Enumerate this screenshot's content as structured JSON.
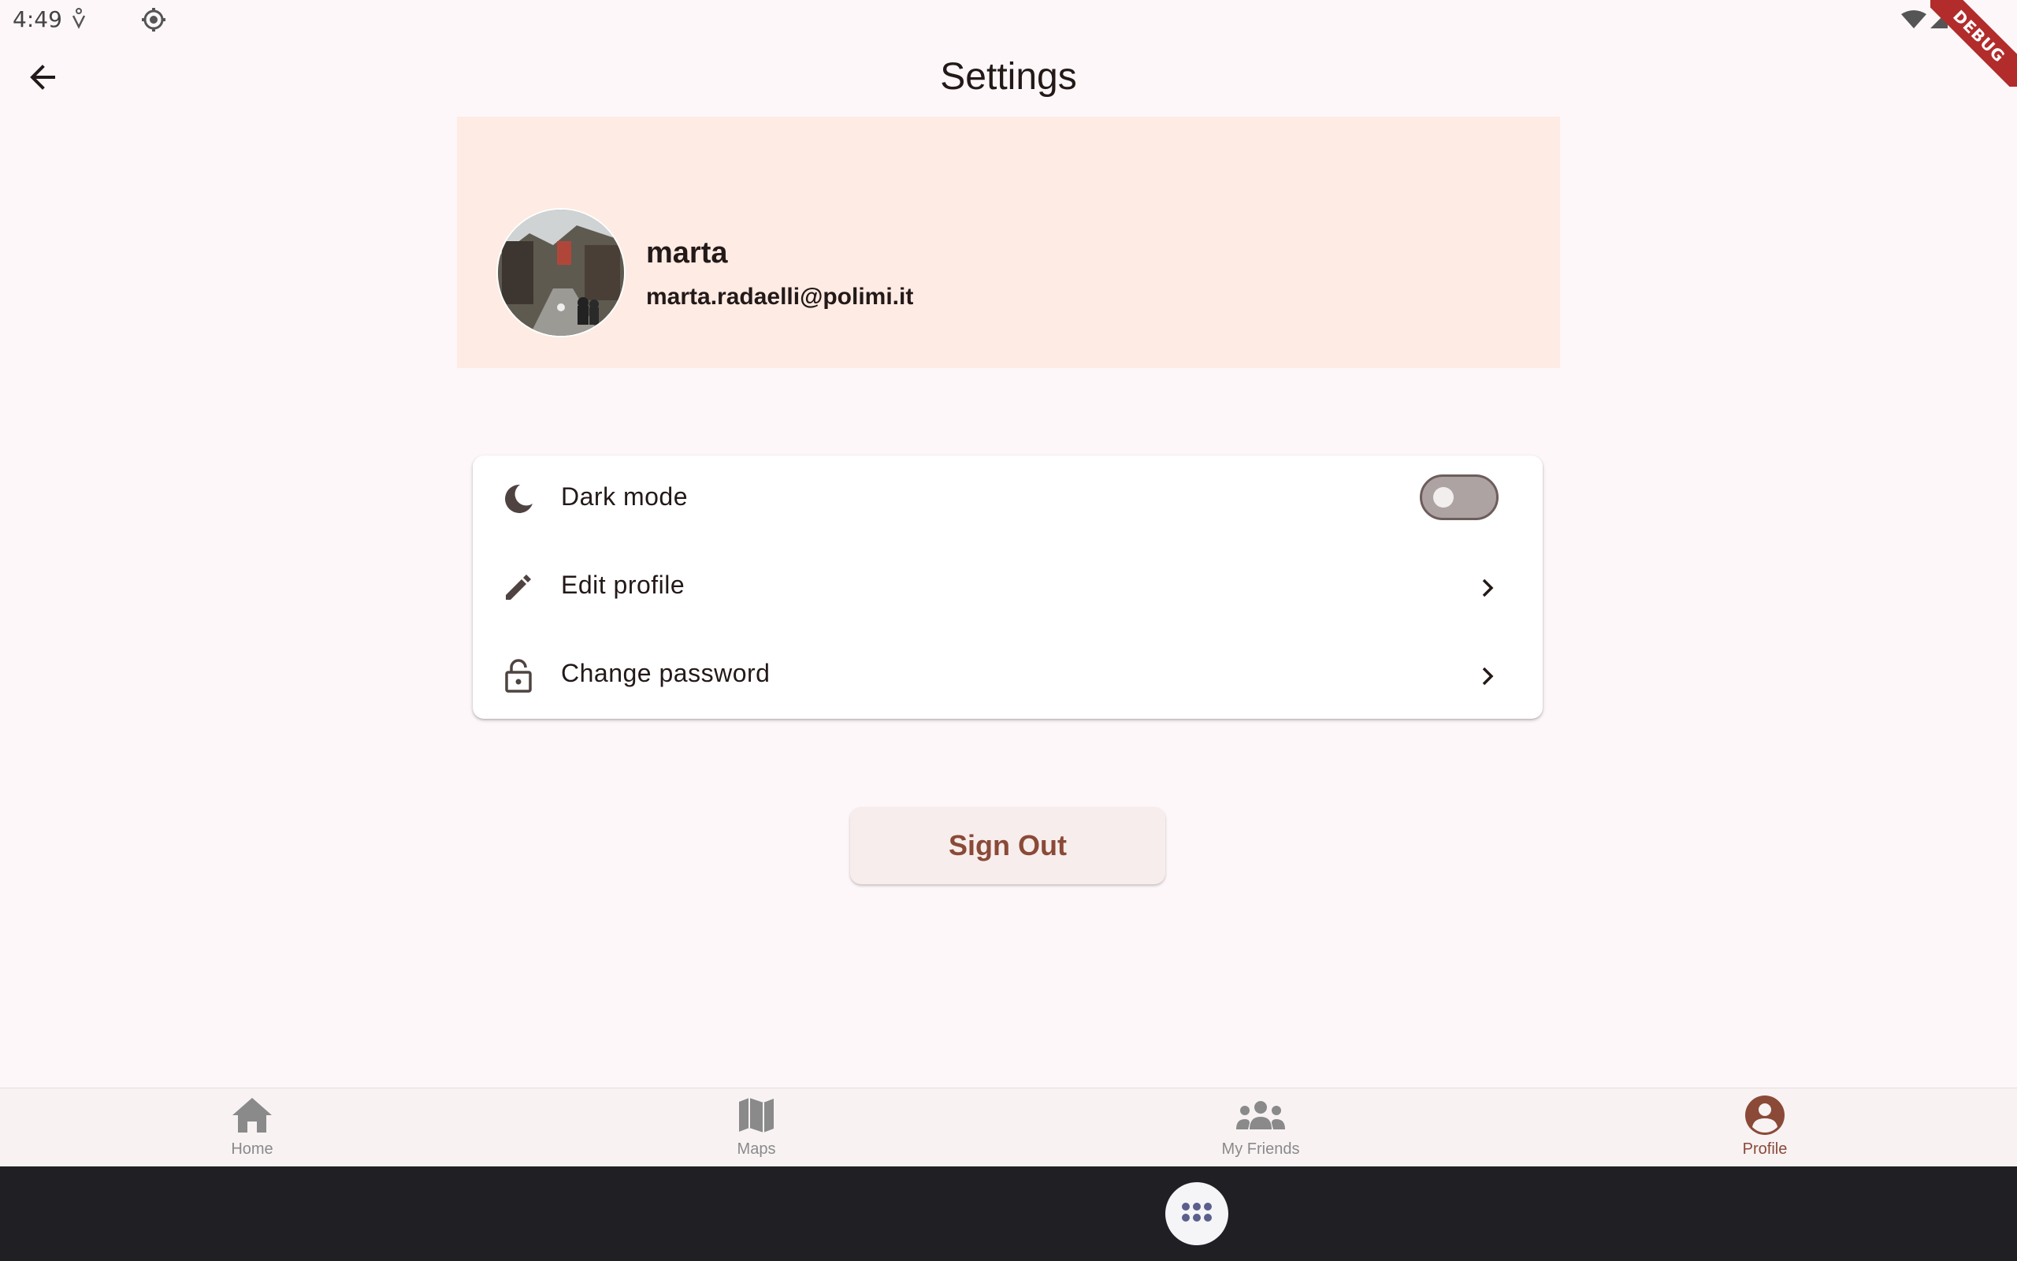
{
  "status_bar": {
    "time": "4:49"
  },
  "app_bar": {
    "title": "Settings",
    "debug_label": "DEBUG"
  },
  "profile": {
    "name": "marta",
    "email": "marta.radaelli@polimi.it"
  },
  "settings": {
    "items": [
      {
        "label": "Dark mode",
        "icon": "moon-icon",
        "type": "toggle",
        "value": false
      },
      {
        "label": "Edit profile",
        "icon": "pencil-icon",
        "type": "link"
      },
      {
        "label": "Change password",
        "icon": "lock-icon",
        "type": "link"
      }
    ]
  },
  "actions": {
    "sign_out": "Sign Out"
  },
  "bottom_nav": {
    "items": [
      {
        "label": "Home",
        "icon": "home-icon",
        "active": false
      },
      {
        "label": "Maps",
        "icon": "map-icon",
        "active": false
      },
      {
        "label": "My Friends",
        "icon": "group-icon",
        "active": false
      },
      {
        "label": "Profile",
        "icon": "account-circle-icon",
        "active": true
      }
    ]
  },
  "colors": {
    "background": "#fdf7f9",
    "header_bg": "#fdebe4",
    "accent": "#8a4a37",
    "text": "#231918",
    "inactive_nav": "#8a8a8a"
  }
}
